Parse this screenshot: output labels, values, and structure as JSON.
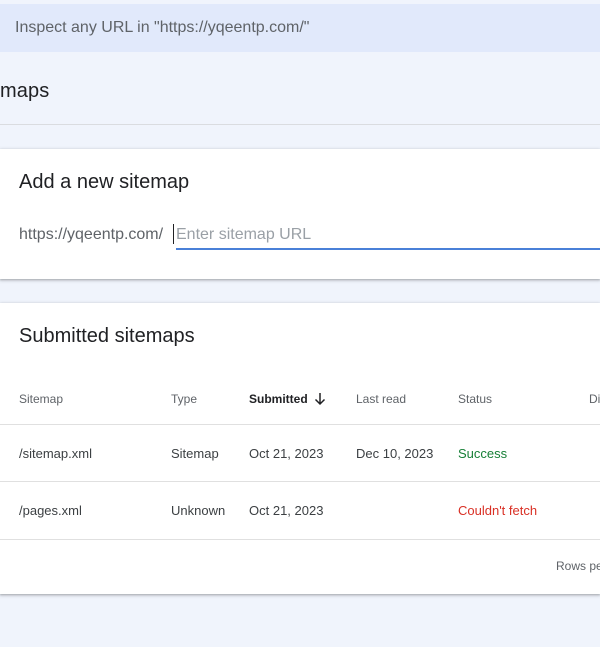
{
  "inspect_bar": {
    "text": "Inspect any URL in \"https://yqeentp.com/\""
  },
  "page": {
    "title": "maps"
  },
  "add_sitemap": {
    "title": "Add a new sitemap",
    "url_prefix": "https://yqeentp.com/",
    "input_value": "",
    "input_placeholder": "Enter sitemap URL"
  },
  "submitted": {
    "title": "Submitted sitemaps",
    "columns": {
      "sitemap": "Sitemap",
      "type": "Type",
      "submitted": "Submitted",
      "last_read": "Last read",
      "status": "Status",
      "discovered": "Di"
    },
    "rows": [
      {
        "sitemap": "/sitemap.xml",
        "type": "Sitemap",
        "submitted": "Oct 21, 2023",
        "last_read": "Dec 10, 2023",
        "status": "Success"
      },
      {
        "sitemap": "/pages.xml",
        "type": "Unknown",
        "submitted": "Oct 21, 2023",
        "last_read": "",
        "status": "Couldn't fetch"
      }
    ],
    "footer": {
      "rows_per_page": "Rows pe"
    },
    "sort_icon": "arrow-down-icon"
  },
  "colors": {
    "background": "#f0f4fc",
    "inspect_bar": "#e1e9fb",
    "accent": "#4a80d8",
    "success": "#188038",
    "error": "#d93025"
  }
}
